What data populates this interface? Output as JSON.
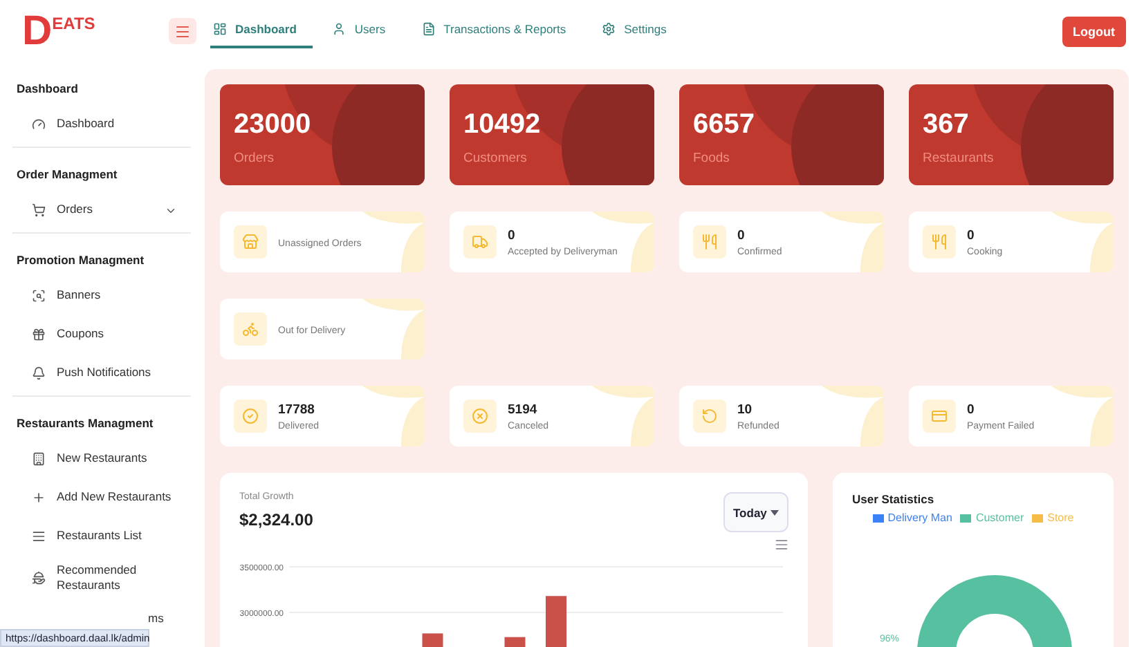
{
  "logo": {
    "mark": "D",
    "text": "EATS"
  },
  "nav": [
    {
      "label": "Dashboard",
      "selected": true
    },
    {
      "label": "Users",
      "selected": false
    },
    {
      "label": "Transactions & Reports",
      "selected": false
    },
    {
      "label": "Settings",
      "selected": false
    }
  ],
  "logout": "Logout",
  "sidebar": [
    {
      "title": "Dashboard",
      "items": [
        {
          "label": "Dashboard",
          "expandable": false
        }
      ]
    },
    {
      "title": "Order Managment",
      "items": [
        {
          "label": "Orders",
          "expandable": true
        }
      ]
    },
    {
      "title": "Promotion Managment",
      "items": [
        {
          "label": "Banners",
          "expandable": false
        },
        {
          "label": "Coupons",
          "expandable": false
        },
        {
          "label": "Push Notifications",
          "expandable": false
        }
      ]
    },
    {
      "title": "Restaurants Managment",
      "items": [
        {
          "label": "New Restaurants",
          "expandable": false
        },
        {
          "label": "Add New Restaurants",
          "expandable": false
        },
        {
          "label": "Restaurants List",
          "expandable": false
        },
        {
          "label": "Recommended Restaurants",
          "expandable": false
        },
        {
          "label": "ms",
          "expandable": false
        }
      ]
    }
  ],
  "status_url": "https://dashboard.daal.lk/admin",
  "summary_cards": [
    {
      "value": "23000",
      "label": "Orders"
    },
    {
      "value": "10492",
      "label": "Customers"
    },
    {
      "value": "6657",
      "label": "Foods"
    },
    {
      "value": "367",
      "label": "Restaurants"
    }
  ],
  "status_rows": [
    [
      {
        "label": "Unassigned Orders"
      },
      {
        "value": "0",
        "label": "Accepted by Deliveryman"
      },
      {
        "value": "0",
        "label": "Confirmed"
      },
      {
        "value": "0",
        "label": "Cooking"
      }
    ],
    [
      {
        "label": "Out for Delivery"
      }
    ],
    [
      {
        "value": "17788",
        "label": "Delivered"
      },
      {
        "value": "5194",
        "label": "Canceled"
      },
      {
        "value": "10",
        "label": "Refunded"
      },
      {
        "value": "0",
        "label": "Payment Failed"
      }
    ]
  ],
  "growth": {
    "title": "Total Growth",
    "amount": "$2,324.00",
    "period": "Today",
    "chart_data": {
      "type": "bar",
      "ylim": [
        2600000,
        3500000
      ],
      "values": [
        null,
        null,
        null,
        2770000,
        null,
        2730000,
        3180000,
        null,
        null,
        null,
        null,
        null
      ],
      "yticks": [
        {
          "value": 3500000,
          "label": "3500000.00"
        },
        {
          "value": 3000000,
          "label": "3000000.00"
        }
      ]
    }
  },
  "user_statistics": {
    "title": "User Statistics",
    "legend": [
      {
        "label": "Delivery Man",
        "color": "#3b82f6"
      },
      {
        "label": "Customer",
        "color": "#56c0a0"
      },
      {
        "label": "Store",
        "color": "#f5bd47"
      }
    ],
    "percent_label": "96%"
  }
}
